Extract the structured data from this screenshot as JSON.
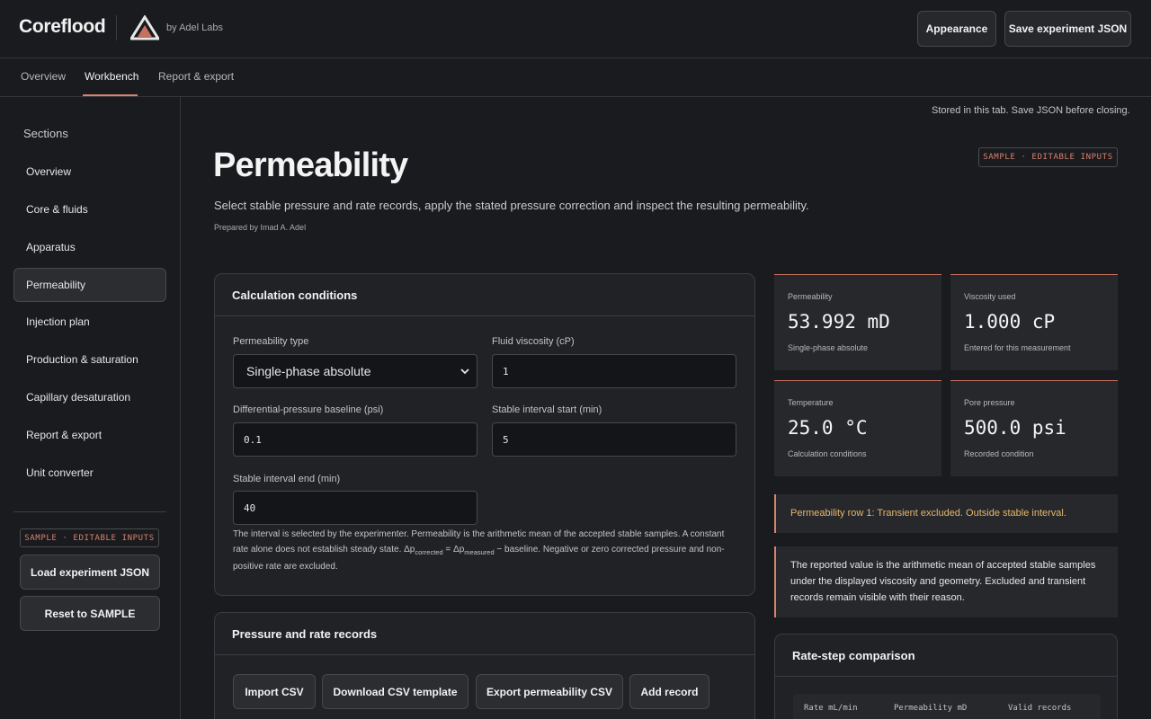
{
  "header": {
    "brand": "Coreflood",
    "byline": "by Adel Labs",
    "appearance_label": "Appearance",
    "save_label": "Save experiment JSON"
  },
  "tabs": [
    {
      "label": "Overview",
      "active": false
    },
    {
      "label": "Workbench",
      "active": true
    },
    {
      "label": "Report & export",
      "active": false
    }
  ],
  "sidebar": {
    "title": "Sections",
    "items": [
      {
        "label": "Overview"
      },
      {
        "label": "Core & fluids"
      },
      {
        "label": "Apparatus"
      },
      {
        "label": "Permeability",
        "active": true
      },
      {
        "label": "Injection plan"
      },
      {
        "label": "Production & saturation"
      },
      {
        "label": "Capillary desaturation"
      },
      {
        "label": "Report & export"
      },
      {
        "label": "Unit converter"
      }
    ],
    "badge": "SAMPLE · EDITABLE INPUTS",
    "load_label": "Load experiment JSON",
    "reset_label": "Reset to SAMPLE"
  },
  "main": {
    "stored_note": "Stored in this tab. Save JSON before closing.",
    "badge": "SAMPLE · EDITABLE INPUTS",
    "title": "Permeability",
    "description": "Select stable pressure and rate records, apply the stated pressure correction and inspect the resulting permeability.",
    "prepared_by": "Prepared by Imad A. Adel"
  },
  "calc": {
    "title": "Calculation conditions",
    "perm_type_label": "Permeability type",
    "perm_type_value": "Single-phase absolute",
    "viscosity_label": "Fluid viscosity (cP)",
    "viscosity_value": "1",
    "baseline_label": "Differential-pressure baseline (psi)",
    "baseline_value": "0.1",
    "start_label": "Stable interval start (min)",
    "start_value": "5",
    "end_label": "Stable interval end (min)",
    "end_value": "40",
    "note_pre": "The interval is selected by the experimenter. Permeability is the arithmetic mean of the accepted stable samples. A constant rate alone does not establish steady state. Δp",
    "note_sub1": "corrected",
    "note_mid": " = Δp",
    "note_sub2": "measured",
    "note_post": " − baseline. Negative or zero corrected pressure and non-positive rate are excluded."
  },
  "records": {
    "title": "Pressure and rate records",
    "import_label": "Import CSV",
    "template_label": "Download CSV template",
    "export_label": "Export permeability CSV",
    "add_label": "Add record"
  },
  "metrics": [
    {
      "label": "Permeability",
      "value": "53.992 mD",
      "sub": "Single-phase absolute"
    },
    {
      "label": "Viscosity used",
      "value": "1.000 cP",
      "sub": "Entered for this measurement"
    },
    {
      "label": "Temperature",
      "value": "25.0 °C",
      "sub": "Calculation conditions"
    },
    {
      "label": "Pore pressure",
      "value": "500.0 psi",
      "sub": "Recorded condition"
    }
  ],
  "warning": "Permeability row 1: Transient excluded. Outside stable interval.",
  "info": "The reported value is the arithmetic mean of accepted stable samples under the displayed viscosity and geometry. Excluded and transient records remain visible with their reason.",
  "ratestep": {
    "title": "Rate-step comparison",
    "columns": [
      "Rate mL/min",
      "Permeability mD",
      "Valid records"
    ]
  },
  "colors": {
    "accent": "#d9826f",
    "warning_text": "#e8b66b",
    "background": "#1a1b1e"
  }
}
